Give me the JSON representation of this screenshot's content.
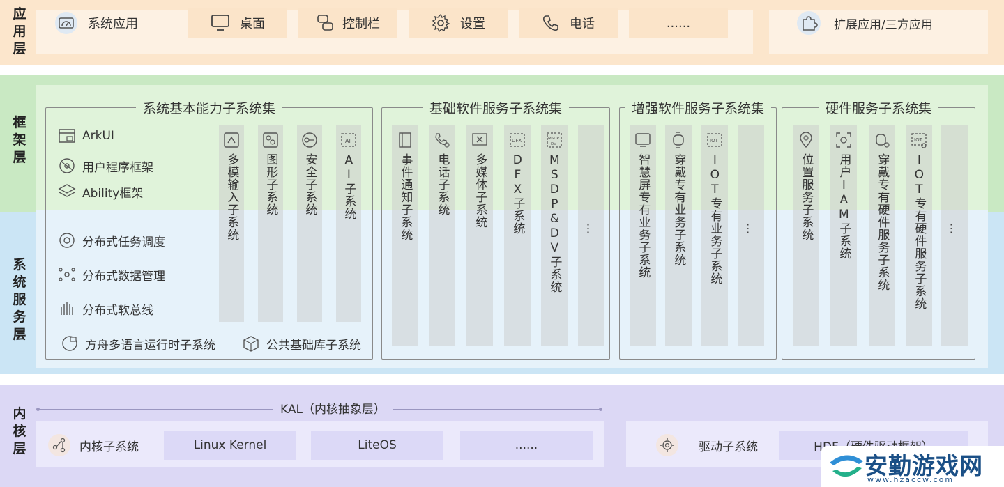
{
  "layers": {
    "app": "应\n用\n层",
    "framework": "框\n架\n层",
    "system": "系\n统\n服\n务\n层",
    "kernel": "内\n核\n层"
  },
  "app": {
    "items": [
      "系统应用",
      "桌面",
      "控制栏",
      "设置",
      "电话",
      "......"
    ],
    "ext": "扩展应用/三方应用"
  },
  "groups": {
    "basic": {
      "title": "系统基本能力子系统集",
      "items": [
        "ArkUI",
        "用户程序框架",
        "Ability框架",
        "分布式任务调度",
        "分布式数据管理",
        "分布式软总线",
        "方舟多语言运行时子系统",
        "公共基础库子系统"
      ],
      "cols": [
        "多模输入子系统",
        "图形子系统",
        "安全子系统",
        "AI子系统"
      ]
    },
    "software": {
      "title": "基础软件服务子系统集",
      "cols": [
        "事件通知子系统",
        "电话子系统",
        "多媒体子系统",
        "DFX子系统",
        "MSDP&DV子系统",
        "…"
      ]
    },
    "enhanced": {
      "title": "增强软件服务子系统集",
      "cols": [
        "智慧屏专有业务子系统",
        "穿戴专有业务子系统",
        "IOT专有业务子系统",
        "…"
      ]
    },
    "hardware": {
      "title": "硬件服务子系统集",
      "cols": [
        "位置服务子系统",
        "用户IAM子系统",
        "穿戴专有硬件服务子系统",
        "IOT专有硬件服务子系统",
        "…"
      ]
    }
  },
  "kernel": {
    "kal": "KAL（内核抽象层）",
    "subsystem": "内核子系统",
    "items": [
      "Linux Kernel",
      "LiteOS",
      "......"
    ],
    "driver": "驱动子系统",
    "hdf": "HDF（硬件驱动框架）"
  },
  "watermark": {
    "text": "安勤游戏网",
    "url": "www.hzaccw.com"
  },
  "icons": {
    "app": [
      "dashboard-icon",
      "monitor-icon",
      "control-bar-icon",
      "gear-icon",
      "phone-icon"
    ],
    "ext": "puzzle-icon"
  }
}
